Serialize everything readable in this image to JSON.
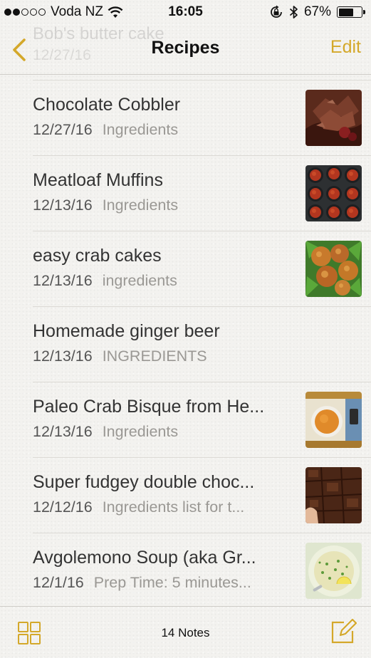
{
  "status_bar": {
    "carrier": "Voda NZ",
    "signal_bars": 2,
    "signal_total": 5,
    "time": "16:05",
    "battery_text": "67%",
    "battery_level": 0.67
  },
  "nav": {
    "title": "Recipes",
    "edit_label": "Edit",
    "ghost_title": "Bob's butter cake",
    "ghost_date": "12/27/16"
  },
  "notes": [
    {
      "title": "Chocolate Cobbler",
      "date": "12/27/16",
      "snippet": "Ingredients",
      "thumb": "cobbler"
    },
    {
      "title": "Meatloaf Muffins",
      "date": "12/13/16",
      "snippet": "Ingredients",
      "thumb": "muffins"
    },
    {
      "title": "easy crab cakes",
      "date": "12/13/16",
      "snippet": "ingredients",
      "thumb": "crabcakes"
    },
    {
      "title": "Homemade ginger beer",
      "date": "12/13/16",
      "snippet": "INGREDIENTS",
      "thumb": ""
    },
    {
      "title": "Paleo Crab Bisque from He...",
      "date": "12/13/16",
      "snippet": "Ingredients",
      "thumb": "bisque"
    },
    {
      "title": "Super fudgey double choc...",
      "date": "12/12/16",
      "snippet": "Ingredients list for t...",
      "thumb": "brownies"
    },
    {
      "title": "Avgolemono Soup (aka Gr...",
      "date": "12/1/16",
      "snippet": "Prep Time: 5 minutes...",
      "thumb": "soup"
    }
  ],
  "toolbar": {
    "note_count": "14 Notes"
  },
  "colors": {
    "accent": "#d4a82a",
    "background": "#f3f2ef"
  },
  "icons": [
    "back-chevron-icon",
    "wifi-icon",
    "lock-rotation-icon",
    "bluetooth-icon",
    "battery-icon",
    "gallery-grid-icon",
    "compose-icon"
  ]
}
